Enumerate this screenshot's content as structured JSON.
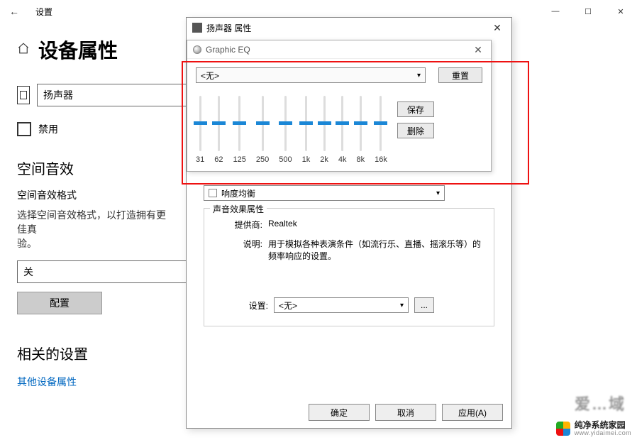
{
  "titlebar": {
    "title": "设置"
  },
  "win_controls": {
    "min": "—",
    "max": "☐",
    "close": "✕"
  },
  "page": {
    "heading": "设备属性",
    "device_selected": "扬声器",
    "disable_label": "禁用",
    "spatial_heading": "空间音效",
    "spatial_format_label": "空间音效格式",
    "spatial_desc": "选择空间音效格式，以打造拥有更佳真",
    "spatial_desc2": "验。",
    "spatial_value": "关",
    "configure_btn": "配置",
    "related_heading": "相关的设置",
    "related_link": "其他设备属性"
  },
  "speaker_dialog": {
    "title": "扬声器 属性",
    "behind_select": "响度均衡",
    "group_legend": "声音效果属性",
    "provider_k": "提供商:",
    "provider_v": "Realtek",
    "desc_k": "说明:",
    "desc_v": "用于模拟各种表演条件（如流行乐、直播、摇滚乐等）的频率响应的设置。",
    "settings_k": "设置:",
    "settings_v": "<无>",
    "dots": "...",
    "ok": "确定",
    "cancel": "取消",
    "apply": "应用(A)"
  },
  "eq": {
    "title": "Graphic EQ",
    "preset": "<无>",
    "reset": "重置",
    "save": "保存",
    "delete": "删除",
    "bands": [
      "31",
      "62",
      "125",
      "250",
      "500",
      "1k",
      "2k",
      "4k",
      "8k",
      "16k"
    ]
  },
  "watermark": {
    "brand": "纯净系统家园",
    "url": "www.yidaimei.com",
    "behind": "爱…域"
  }
}
